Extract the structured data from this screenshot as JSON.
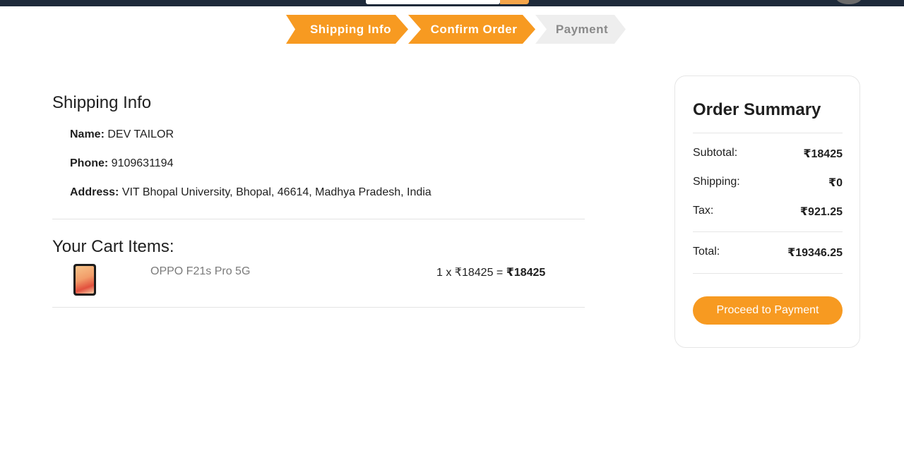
{
  "stepper": {
    "steps": [
      {
        "label": "Shipping Info",
        "state": "active"
      },
      {
        "label": "Confirm Order",
        "state": "active"
      },
      {
        "label": "Payment",
        "state": "inactive"
      }
    ]
  },
  "shipping": {
    "title": "Shipping Info",
    "name_label": "Name:",
    "name_value": "DEV TAILOR",
    "phone_label": "Phone:",
    "phone_value": "9109631194",
    "address_label": "Address:",
    "address_value": "VIT Bhopal University, Bhopal, 46614, Madhya Pradesh, India"
  },
  "cart": {
    "title": "Your Cart Items:",
    "items": [
      {
        "name": "OPPO F21s Pro 5G",
        "qty_price": "1 x ₹18425 = ",
        "total": "₹18425"
      }
    ]
  },
  "summary": {
    "title": "Order Summary",
    "subtotal_label": "Subtotal:",
    "subtotal_value": "₹18425",
    "shipping_label": "Shipping:",
    "shipping_value": "₹0",
    "tax_label": "Tax:",
    "tax_value": "₹921.25",
    "total_label": "Total:",
    "total_value": "₹19346.25",
    "button_label": "Proceed to Payment"
  },
  "colors": {
    "accent": "#f79a21",
    "navbar": "#1e2a3a",
    "inactive_step": "#eeeeee"
  }
}
